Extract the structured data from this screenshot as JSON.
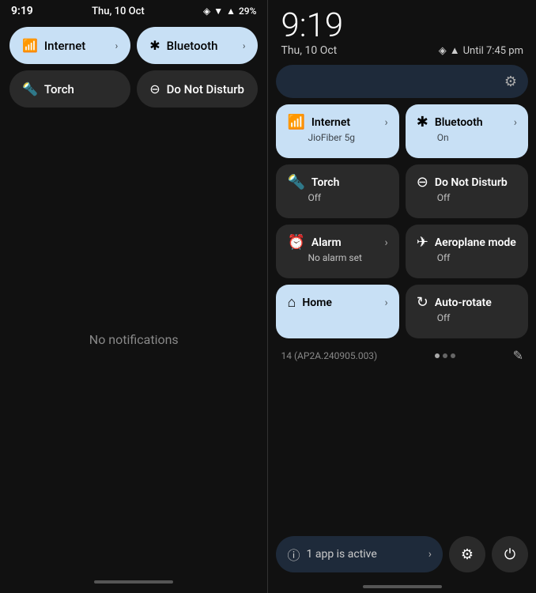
{
  "left": {
    "status": {
      "time": "9:19",
      "date": "Thu, 10 Oct",
      "icons": "◈ ▼ 🔋 29%"
    },
    "tiles": [
      {
        "id": "internet",
        "label": "Internet",
        "active": true,
        "hasChevron": true,
        "icon": "wifi"
      },
      {
        "id": "bluetooth",
        "label": "Bluetooth",
        "active": true,
        "hasChevron": true,
        "icon": "bluetooth"
      },
      {
        "id": "torch",
        "label": "Torch",
        "active": false,
        "hasChevron": false,
        "icon": "torch"
      },
      {
        "id": "dnd",
        "label": "Do Not Disturb",
        "active": false,
        "hasChevron": false,
        "icon": "dnd"
      }
    ],
    "notification_text": "No notifications",
    "home_bar": true
  },
  "right": {
    "time": "9:19",
    "date": "Thu, 10 Oct",
    "until": "Until 7:45 pm",
    "tiles": [
      {
        "id": "internet",
        "title": "Internet",
        "subtitle": "JioFiber 5g",
        "active": true,
        "hasChevron": true,
        "icon": "wifi"
      },
      {
        "id": "bluetooth",
        "title": "Bluetooth",
        "subtitle": "On",
        "active": true,
        "hasChevron": true,
        "icon": "bluetooth"
      },
      {
        "id": "torch",
        "title": "Torch",
        "subtitle": "Off",
        "active": false,
        "hasChevron": false,
        "icon": "torch"
      },
      {
        "id": "dnd",
        "title": "Do Not Disturb",
        "subtitle": "Off",
        "active": false,
        "hasChevron": false,
        "icon": "dnd"
      },
      {
        "id": "alarm",
        "title": "Alarm",
        "subtitle": "No alarm set",
        "active": false,
        "hasChevron": true,
        "icon": "alarm"
      },
      {
        "id": "aeroplane",
        "title": "Aeroplane mode",
        "subtitle": "Off",
        "active": false,
        "hasChevron": false,
        "icon": "plane"
      },
      {
        "id": "home",
        "title": "Home",
        "subtitle": "",
        "active": true,
        "hasChevron": true,
        "icon": "home"
      },
      {
        "id": "autorotate",
        "title": "Auto-rotate",
        "subtitle": "Off",
        "active": false,
        "hasChevron": false,
        "icon": "rotate"
      }
    ],
    "build": "14 (AP2A.240905.003)",
    "active_app": "1 app is active",
    "gear_label": "⚙",
    "power_label": "⏻"
  }
}
